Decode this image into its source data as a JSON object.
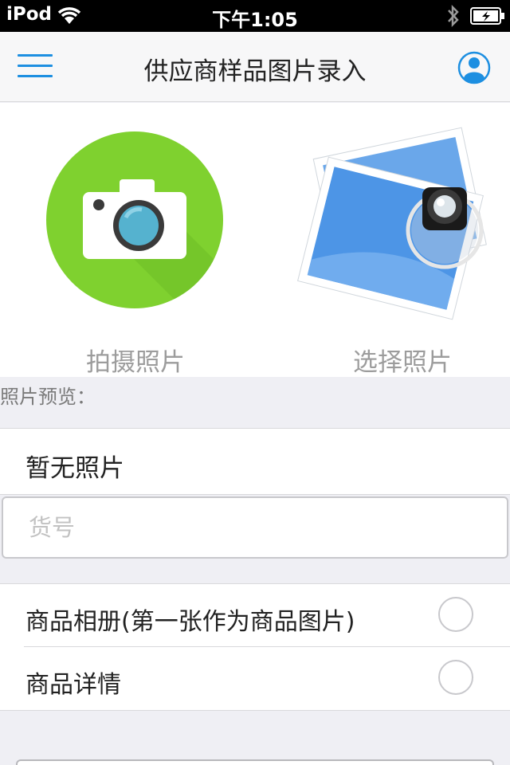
{
  "status_bar": {
    "carrier": "iPod",
    "time": "下午1:05"
  },
  "nav": {
    "title": "供应商样品图片录入",
    "menu_icon": "hamburger-menu-icon",
    "user_icon": "user-profile-icon",
    "accent_color": "#1d8fe1"
  },
  "actions": {
    "take_photo_label": "拍摄照片",
    "pick_photo_label": "选择照片",
    "camera_bg_color": "#7fd12f"
  },
  "preview": {
    "section_label": "照片预览：",
    "empty_text": "暂无照片"
  },
  "sku": {
    "placeholder": "货号",
    "value": ""
  },
  "options": [
    {
      "label": "商品相册(第一张作为商品图片)",
      "selected": false
    },
    {
      "label": "商品详情",
      "selected": false
    }
  ]
}
